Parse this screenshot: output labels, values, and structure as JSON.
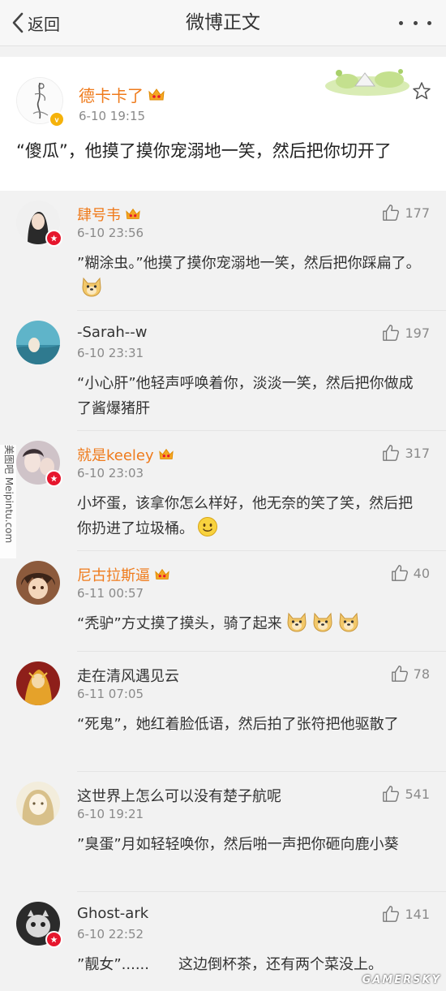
{
  "navbar": {
    "back_label": "返回",
    "title": "微博正文"
  },
  "post": {
    "author": "德卡卡了",
    "time": "6-10 19:15",
    "text": "“傻瓜”，他摸了摸你宠溺地一笑，然后把你切开了"
  },
  "comments": [
    {
      "author": "肆号韦",
      "vip": true,
      "badge": true,
      "time": "6-10 23:56",
      "likes": "177",
      "text": "”糊涂虫。”他摸了摸你宠溺地一笑，然后把你踩扁了。",
      "emojis": [
        "doge"
      ]
    },
    {
      "author": "-Sarah--w",
      "vip": false,
      "badge": false,
      "time": "6-10 23:31",
      "likes": "197",
      "text": "“小心肝”他轻声呼唤着你，淡淡一笑，然后把你做成了酱爆猪肝",
      "emojis": []
    },
    {
      "author": "就是keeley",
      "vip": true,
      "badge": true,
      "time": "6-10 23:03",
      "likes": "317",
      "text": "小坏蛋，该拿你怎么样好，他无奈的笑了笑，然后把你扔进了垃圾桶。",
      "emojis": [
        "smile"
      ]
    },
    {
      "author": "尼古拉斯逼",
      "vip": true,
      "badge": false,
      "time": "6-11 00:57",
      "likes": "40",
      "text": "“秃驴”方丈摸了摸头，骑了起来",
      "emojis": [
        "doge",
        "doge",
        "doge"
      ]
    },
    {
      "author": "走在清风遇见云",
      "vip": false,
      "badge": false,
      "time": "6-11 07:05",
      "likes": "78",
      "text": "“死鬼”，她红着脸低语，然后拍了张符把他驱散了",
      "emojis": []
    },
    {
      "author": "这世界上怎么可以没有楚子航呢",
      "vip": false,
      "badge": false,
      "time": "6-10 19:21",
      "likes": "541",
      "text": "”臭蛋”月如轻轻唤你，然后啪一声把你砸向鹿小葵",
      "emojis": []
    },
    {
      "author": "Ghost-ark",
      "vip": false,
      "badge": true,
      "time": "6-10 22:52",
      "likes": "141",
      "text": "”靓女”......　　这边倒杯茶，还有两个菜没上。",
      "emojis": []
    }
  ],
  "watermarks": {
    "left": "美图吧 Meipintu.com",
    "bottom": "GAMERSKY"
  },
  "colors": {
    "vip_name": "#ef7b1c",
    "badge_red": "#e6162d",
    "badge_gold": "#f5b20a"
  }
}
